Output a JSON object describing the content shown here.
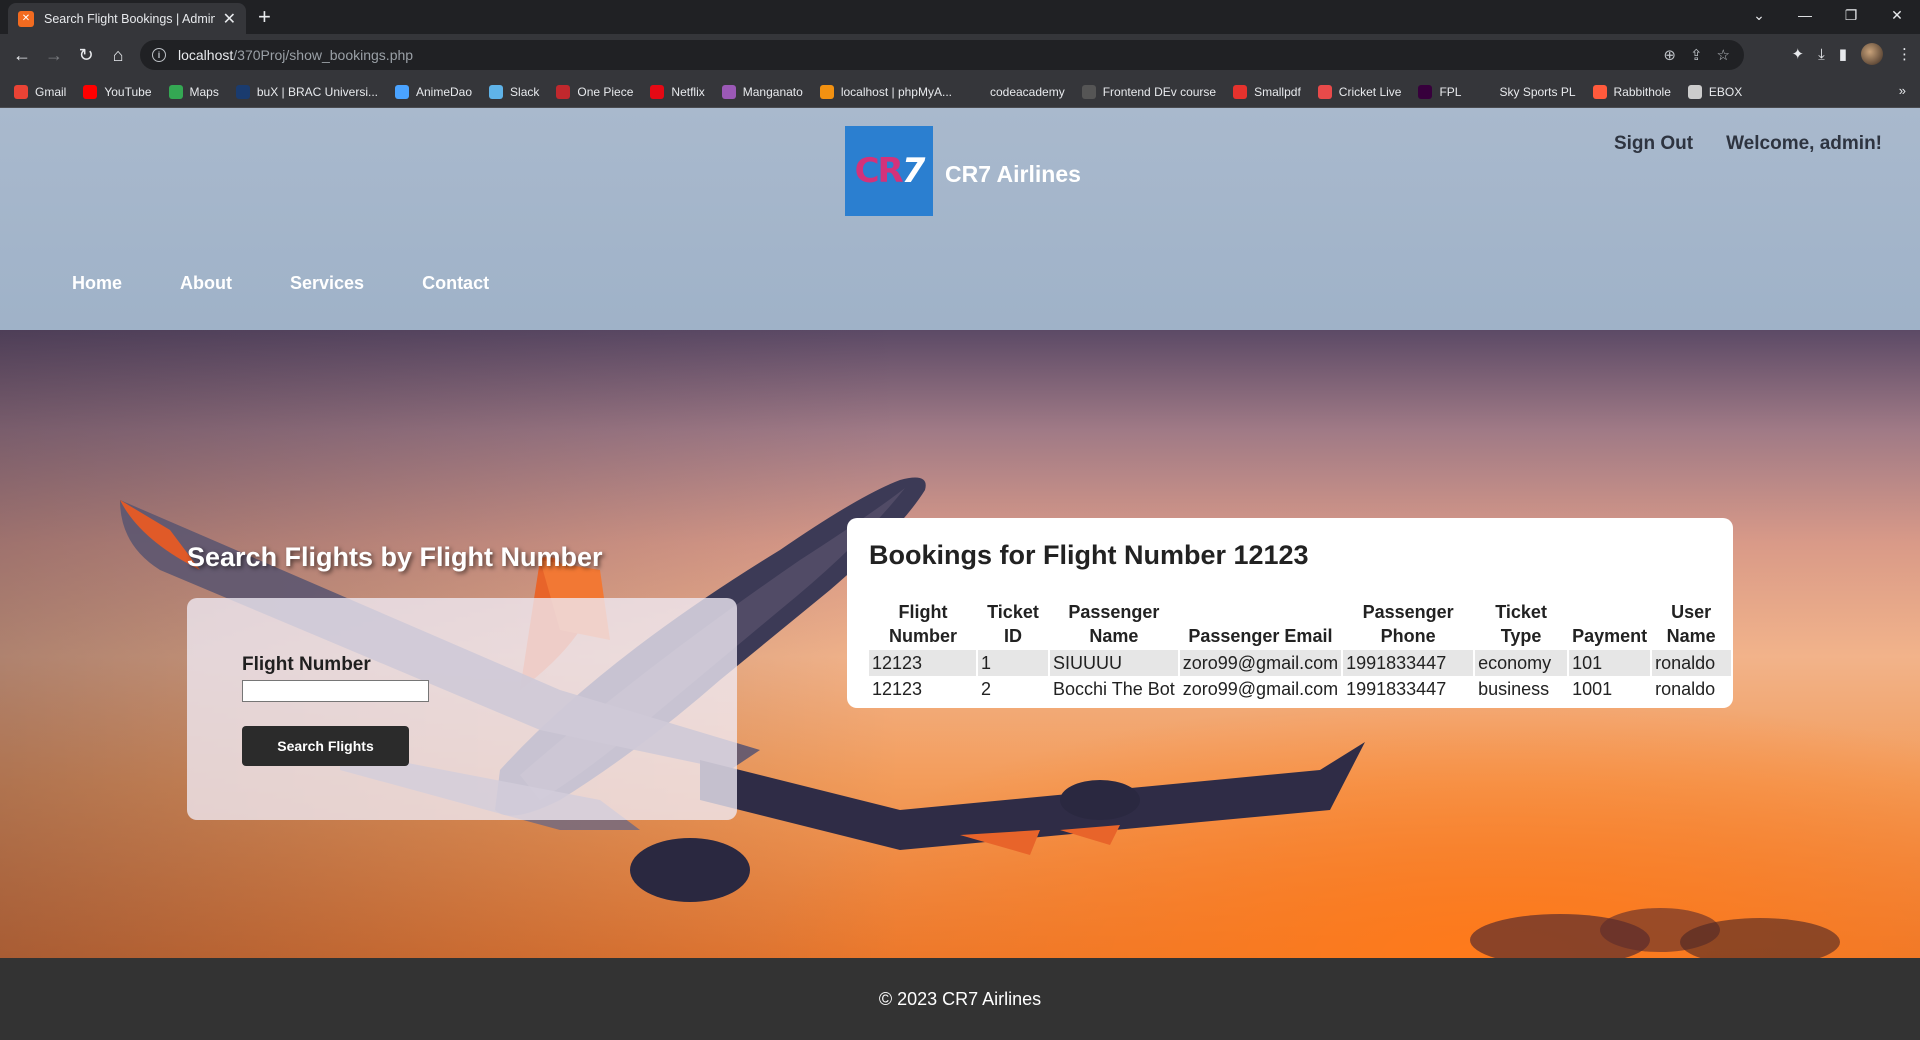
{
  "browser": {
    "tab_title": "Search Flight Bookings | Admin",
    "tab_favicon": "xampp-icon",
    "url_host": "localhost",
    "url_path": "/370Proj/show_bookings.php",
    "bookmarks": [
      {
        "label": "Gmail",
        "color": "#ea4335"
      },
      {
        "label": "YouTube",
        "color": "#ff0000"
      },
      {
        "label": "Maps",
        "color": "#34a853"
      },
      {
        "label": "buX | BRAC Universi...",
        "color": "#1a3b6e"
      },
      {
        "label": "AnimeDao",
        "color": "#4aa3ff"
      },
      {
        "label": "Slack",
        "color": "#5fb3e8"
      },
      {
        "label": "One Piece",
        "color": "#c0282d"
      },
      {
        "label": "Netflix",
        "color": "#e50914"
      },
      {
        "label": "Manganato",
        "color": "#9b59b6"
      },
      {
        "label": "localhost | phpMyA...",
        "color": "#f29111"
      },
      {
        "label": "codeacademy",
        "color": "#35363a"
      },
      {
        "label": "Frontend DEv course",
        "color": "#555555"
      },
      {
        "label": "Smallpdf",
        "color": "#e5322d"
      },
      {
        "label": "Cricket Live",
        "color": "#e84a4a"
      },
      {
        "label": "FPL",
        "color": "#37003c"
      },
      {
        "label": "Sky Sports PL",
        "color": "#35363a"
      },
      {
        "label": "Rabbithole",
        "color": "#ff5a3c"
      },
      {
        "label": "EBOX",
        "color": "#cccccc"
      }
    ]
  },
  "header": {
    "logo_text": "CR",
    "logo_seven": "7",
    "brand_name": "CR7 Airlines",
    "sign_out": "Sign Out",
    "welcome": "Welcome, admin!",
    "nav": [
      "Home",
      "About",
      "Services",
      "Contact"
    ],
    "logo_color": "#2b7fd0"
  },
  "search": {
    "title": "Search Flights by Flight Number",
    "field_label": "Flight Number",
    "field_value": "",
    "button_label": "Search Flights"
  },
  "results": {
    "title": "Bookings for Flight Number 12123",
    "columns": [
      "Flight Number",
      "Ticket ID",
      "Passenger Name",
      "Passenger Email",
      "Passenger Phone",
      "Ticket Type",
      "Payment",
      "User Name"
    ],
    "rows": [
      [
        "12123",
        "1",
        "SIUUUU",
        "zoro99@gmail.com",
        "1991833447",
        "economy",
        "101",
        "ronaldo"
      ],
      [
        "12123",
        "2",
        "Bocchi The Bot",
        "zoro99@gmail.com",
        "1991833447",
        "business",
        "1001",
        "ronaldo"
      ]
    ]
  },
  "footer": {
    "copyright": "© 2023 CR7 Airlines"
  }
}
